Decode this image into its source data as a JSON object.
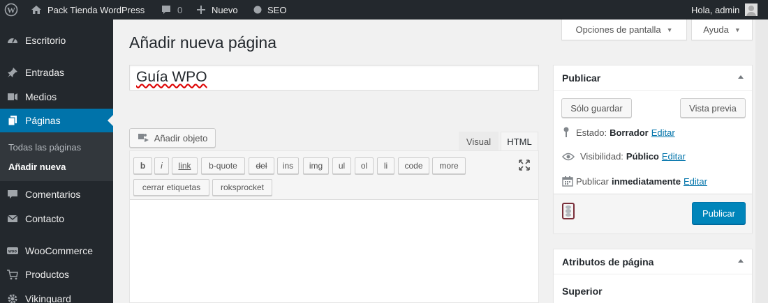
{
  "adminbar": {
    "site_name": "Pack Tienda WordPress",
    "comments_count": "0",
    "new_label": "Nuevo",
    "seo_label": "SEO",
    "greeting": "Hola, admin"
  },
  "sidebar": {
    "items": [
      {
        "label": "Escritorio",
        "icon": "dashboard-icon"
      },
      {
        "label": "Entradas",
        "icon": "pin-icon"
      },
      {
        "label": "Medios",
        "icon": "media-icon"
      },
      {
        "label": "Páginas",
        "icon": "pages-icon"
      },
      {
        "label": "Comentarios",
        "icon": "comments-icon"
      },
      {
        "label": "Contacto",
        "icon": "mail-icon"
      },
      {
        "label": "WooCommerce",
        "icon": "woocommerce-icon"
      },
      {
        "label": "Productos",
        "icon": "cart-icon"
      },
      {
        "label": "Vikinguard",
        "icon": "gear-icon"
      }
    ],
    "submenu": [
      "Todas las páginas",
      "Añadir nueva"
    ]
  },
  "header": {
    "title": "Añadir nueva página",
    "screen_options": "Opciones de pantalla",
    "help": "Ayuda"
  },
  "editor": {
    "title_value": "Guía WPO",
    "add_media": "Añadir objeto",
    "tab_visual": "Visual",
    "tab_html": "HTML",
    "quicktags": [
      "b",
      "i",
      "link",
      "b-quote",
      "del",
      "ins",
      "img",
      "ul",
      "ol",
      "li",
      "code",
      "more",
      "cerrar etiquetas",
      "roksprocket"
    ]
  },
  "publish_box": {
    "title": "Publicar",
    "save_draft": "Sólo guardar",
    "preview": "Vista previa",
    "status_label": "Estado:",
    "status_value": "Borrador",
    "visibility_label": "Visibilidad:",
    "visibility_value": "Público",
    "schedule_label": "Publicar",
    "schedule_value": "inmediatamente",
    "edit_link": "Editar",
    "publish_button": "Publicar"
  },
  "attributes_box": {
    "title": "Atributos de página",
    "parent_label": "Superior"
  },
  "colors": {
    "admin_dark": "#23282d",
    "accent_blue": "#0073aa",
    "primary_button": "#0085ba"
  }
}
